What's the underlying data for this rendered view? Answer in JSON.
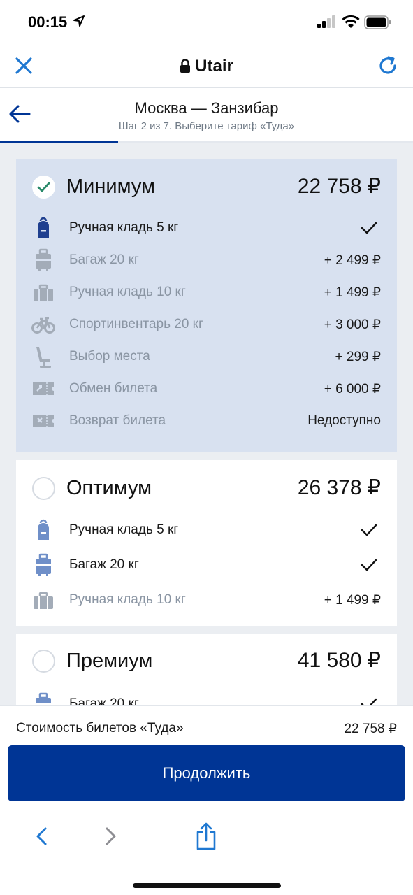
{
  "status": {
    "time": "00:15"
  },
  "browser": {
    "title": "Utair"
  },
  "header": {
    "title": "Москва — Занзибар",
    "subtitle": "Шаг 2 из 7. Выберите тариф «Туда»",
    "progress": 0.286
  },
  "tariffs": [
    {
      "name": "Минимум",
      "price": "22 758 ₽",
      "selected": true,
      "features": [
        {
          "icon": "backpack-icon",
          "label": "Ручная кладь 5 кг",
          "value": "",
          "included": true
        },
        {
          "icon": "suitcase-icon",
          "label": "Багаж 20 кг",
          "value": "+ 2 499 ₽",
          "included": false
        },
        {
          "icon": "bag-icon",
          "label": "Ручная кладь 10 кг",
          "value": "+ 1 499 ₽",
          "included": false
        },
        {
          "icon": "bicycle-icon",
          "label": "Спортинвентарь 20 кг",
          "value": "+ 3 000 ₽",
          "included": false
        },
        {
          "icon": "seat-icon",
          "label": "Выбор места",
          "value": "+ 299 ₽",
          "included": false
        },
        {
          "icon": "ticket-exchange-icon",
          "label": "Обмен билета",
          "value": "+ 6 000 ₽",
          "included": false
        },
        {
          "icon": "ticket-refund-icon",
          "label": "Возврат билета",
          "value": "Недоступно",
          "included": false
        }
      ]
    },
    {
      "name": "Оптимум",
      "price": "26 378 ₽",
      "selected": false,
      "features": [
        {
          "icon": "backpack-icon",
          "label": "Ручная кладь 5 кг",
          "value": "",
          "included": true
        },
        {
          "icon": "suitcase-icon",
          "label": "Багаж 20 кг",
          "value": "",
          "included": true
        },
        {
          "icon": "bag-icon",
          "label": "Ручная кладь 10 кг",
          "value": "+ 1 499 ₽",
          "included": false
        }
      ]
    },
    {
      "name": "Премиум",
      "price": "41 580 ₽",
      "selected": false,
      "features": [
        {
          "icon": "suitcase-icon",
          "label": "Багаж 20 кг",
          "value": "",
          "included": true
        }
      ]
    }
  ],
  "summary": {
    "label": "Стоимость билетов «Туда»",
    "value": "22 758 ₽",
    "button": "Продолжить"
  },
  "colors": {
    "brand": "#003595",
    "selected_card": "#d8e1f0",
    "background": "#ebeef2",
    "accent_check": "#2a8a6a",
    "icon_active": "#1f3f8f",
    "icon_blue": "#6f8fc8",
    "icon_dim": "#a3acb8"
  }
}
